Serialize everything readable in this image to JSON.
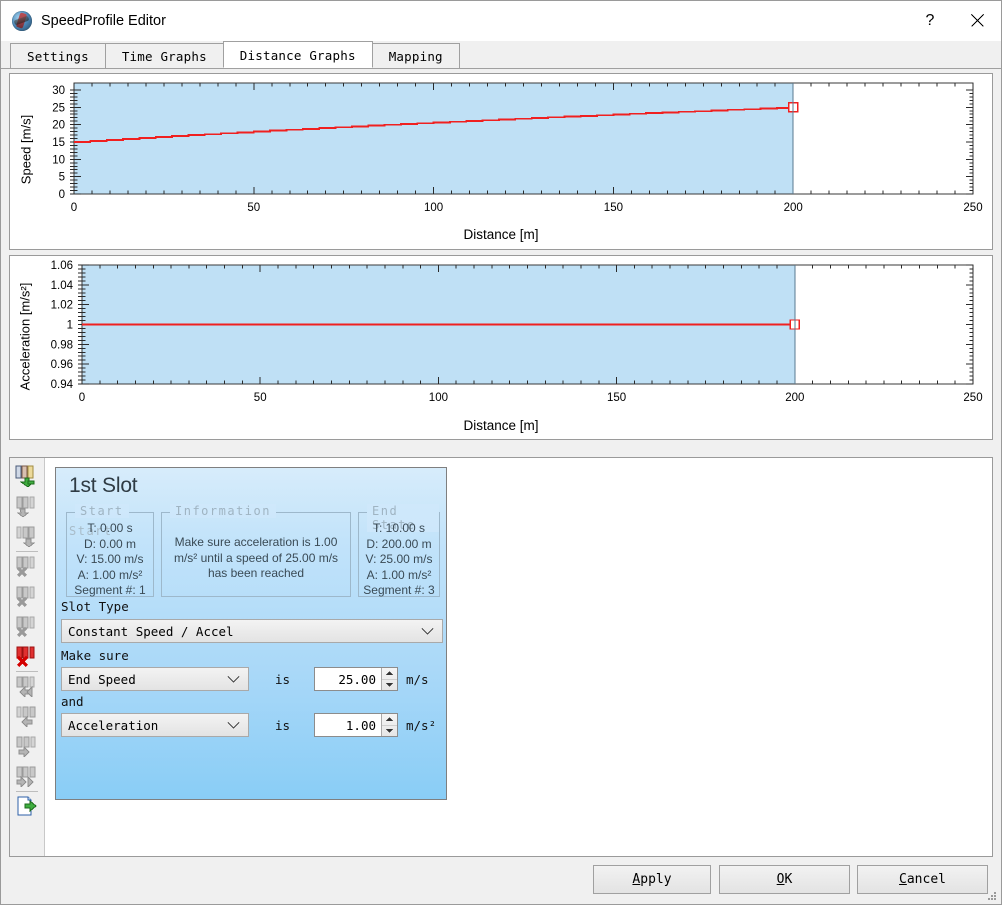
{
  "window": {
    "title": "SpeedProfile Editor",
    "icon": "speedprofile-app-icon",
    "help_label": "?",
    "close_label": "✕"
  },
  "tabs": [
    {
      "label": "Settings",
      "active": false
    },
    {
      "label": "Time Graphs",
      "active": false
    },
    {
      "label": "Distance Graphs",
      "active": true
    },
    {
      "label": "Mapping",
      "active": false
    }
  ],
  "chart_data": [
    {
      "type": "line",
      "name": "speed-vs-distance",
      "title": "",
      "xlabel": "Distance [m]",
      "ylabel": "Speed [m/s]",
      "xlim": [
        0,
        250
      ],
      "ylim": [
        0,
        32
      ],
      "xticks": [
        0,
        50,
        100,
        150,
        200,
        250
      ],
      "yticks": [
        0,
        5,
        10,
        15,
        20,
        25,
        30
      ],
      "grid": false,
      "legend": "none",
      "shaded_region": {
        "x_from": 0,
        "x_to": 200,
        "color": "#bfe0f5"
      },
      "line_color": "#f02020",
      "end_marker": {
        "x": 200,
        "y": 25,
        "shape": "square",
        "color": "#f02020"
      },
      "x": [
        0,
        10,
        20,
        30,
        40,
        50,
        60,
        70,
        80,
        90,
        100,
        110,
        120,
        130,
        140,
        150,
        160,
        170,
        180,
        190,
        200
      ],
      "y": [
        15.0,
        15.65,
        16.28,
        16.88,
        17.46,
        18.03,
        18.57,
        19.1,
        19.62,
        20.12,
        20.62,
        21.1,
        21.56,
        22.02,
        22.47,
        22.91,
        23.35,
        23.77,
        24.19,
        24.6,
        25.0
      ]
    },
    {
      "type": "line",
      "name": "acceleration-vs-distance",
      "title": "",
      "xlabel": "Distance [m]",
      "ylabel": "Acceleration [m/s²]",
      "xlim": [
        0,
        250
      ],
      "ylim": [
        0.94,
        1.06
      ],
      "xticks": [
        0,
        50,
        100,
        150,
        200,
        250
      ],
      "yticks": [
        0.94,
        0.96,
        0.98,
        1,
        1.02,
        1.04,
        1.06
      ],
      "ytick_labels": [
        "0.94",
        "0.96",
        "0.98",
        "1",
        "1.02",
        "1.04",
        "1.06"
      ],
      "grid": false,
      "legend": "none",
      "shaded_region": {
        "x_from": 0,
        "x_to": 200,
        "color": "#bfe0f5"
      },
      "line_color": "#f02020",
      "end_marker": {
        "x": 200,
        "y": 1.0,
        "shape": "square",
        "color": "#f02020"
      },
      "x": [
        0,
        200
      ],
      "y": [
        1.0,
        1.0
      ]
    }
  ],
  "toolbar": {
    "items": [
      {
        "name": "add-slot-icon",
        "sep_above": false
      },
      {
        "name": "insert-slot-before-icon",
        "sep_above": false
      },
      {
        "name": "insert-slot-after-icon",
        "sep_above": false
      },
      {
        "name": "cut-slot-icon",
        "sep_above": true
      },
      {
        "name": "cut-slot-before-icon",
        "sep_above": false
      },
      {
        "name": "cut-slot-after-icon",
        "sep_above": false
      },
      {
        "name": "delete-slot-icon",
        "sep_above": false
      },
      {
        "name": "move-slot-first-icon",
        "sep_above": true
      },
      {
        "name": "move-slot-up-icon",
        "sep_above": false
      },
      {
        "name": "move-slot-down-icon",
        "sep_above": false
      },
      {
        "name": "move-slot-last-icon",
        "sep_above": false
      },
      {
        "name": "export-profile-icon",
        "sep_above": true
      }
    ]
  },
  "slot": {
    "title": "1st Slot",
    "ghost_legend": "Start",
    "start": {
      "legend": "Start",
      "lines": [
        "T: 0.00 s",
        "D: 0.00 m",
        "V: 15.00 m/s",
        "A: 1.00 m/s²",
        "Segment #: 1"
      ]
    },
    "information": {
      "legend": "Information",
      "lines": [
        "Make sure acceleration is 1.00",
        "m/s² until a speed of 25.00 m/s",
        "has been reached"
      ]
    },
    "end_state": {
      "legend": "End State",
      "lines": [
        "T: 10.00 s",
        "D: 200.00 m",
        "V: 25.00 m/s",
        "A: 1.00 m/s²",
        "Segment #: 3"
      ]
    },
    "slot_type_label": "Slot Type",
    "slot_type_value": "Constant Speed / Accel",
    "make_sure_label": "Make sure",
    "and_label": "and",
    "is_label_1": "is",
    "is_label_2": "is",
    "condition1_value": "End Speed",
    "condition1_number": "25.00",
    "condition1_unit": "m/s",
    "condition2_value": "Acceleration",
    "condition2_number": "1.00",
    "condition2_unit": "m/s²"
  },
  "footer": {
    "apply": {
      "pre": "",
      "mnemonic": "A",
      "post": "pply"
    },
    "ok": {
      "pre": "",
      "mnemonic": "O",
      "post": "K"
    },
    "cancel": {
      "pre": "",
      "mnemonic": "C",
      "post": "ancel"
    }
  },
  "colors": {
    "plot_fill": "#bfe0f5",
    "plot_line": "#f02020",
    "card_gradient_top": "#d7ecfb",
    "card_gradient_bottom": "#89cdf6",
    "window_bg": "#f0f0f0"
  }
}
